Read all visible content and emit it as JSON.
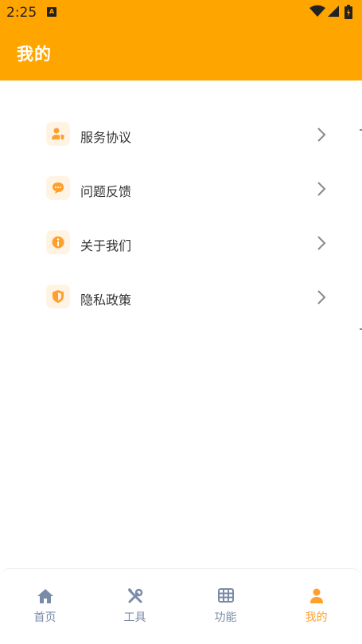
{
  "status_bar": {
    "time": "2:25",
    "notification_badge": "A",
    "icons": [
      "wifi-icon",
      "signal-icon",
      "battery-icon"
    ]
  },
  "header": {
    "title": "我的",
    "background": "#FFA500"
  },
  "menu": {
    "items": [
      {
        "label": "服务协议",
        "icon": "user-shield-icon"
      },
      {
        "label": "问题反馈",
        "icon": "chat-bubble-icon"
      },
      {
        "label": "关于我们",
        "icon": "info-icon"
      },
      {
        "label": "隐私政策",
        "icon": "shield-icon"
      }
    ],
    "accent": "#FFA02E",
    "icon_bg": "#FFF3E3"
  },
  "tabbar": {
    "tabs": [
      {
        "label": "首页",
        "icon": "home-icon",
        "active": false
      },
      {
        "label": "工具",
        "icon": "tools-icon",
        "active": false
      },
      {
        "label": "功能",
        "icon": "grid-icon",
        "active": false
      },
      {
        "label": "我的",
        "icon": "person-icon",
        "active": true
      }
    ],
    "active_color": "#FFA02E",
    "inactive_color": "#7A8BA8"
  }
}
